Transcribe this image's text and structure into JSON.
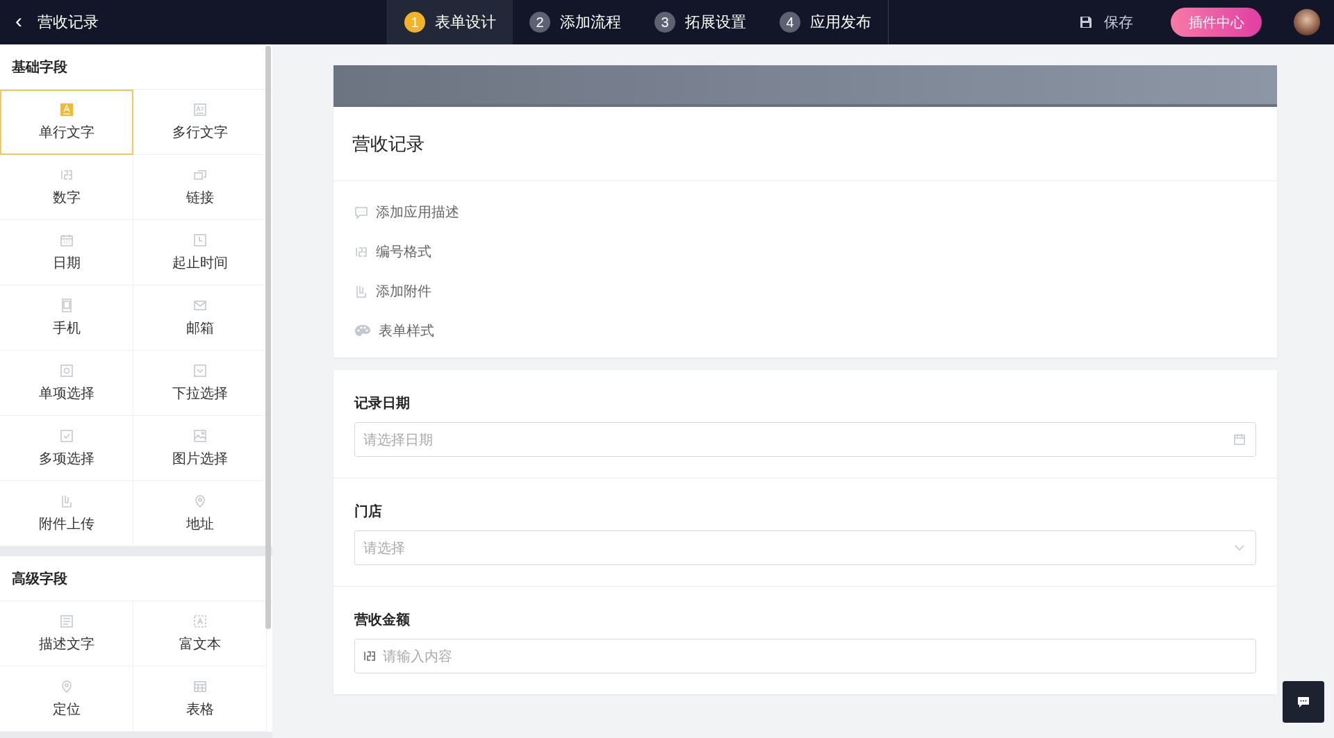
{
  "header": {
    "back": "‹",
    "title": "营收记录",
    "steps": [
      {
        "number": "1",
        "label": "表单设计",
        "selected": true
      },
      {
        "number": "2",
        "label": "添加流程",
        "selected": false
      },
      {
        "number": "3",
        "label": "拓展设置",
        "selected": false
      },
      {
        "number": "4",
        "label": "应用发布",
        "selected": false
      }
    ],
    "save": "保存",
    "plugin_button": "插件中心"
  },
  "sidebar": {
    "sections": [
      {
        "title": "基础字段",
        "items": [
          {
            "label": "单行文字",
            "selected": true
          },
          {
            "label": "多行文字",
            "selected": false
          },
          {
            "label": "数字",
            "selected": false
          },
          {
            "label": "链接",
            "selected": false
          },
          {
            "label": "日期",
            "selected": false
          },
          {
            "label": "起止时间",
            "selected": false
          },
          {
            "label": "手机",
            "selected": false
          },
          {
            "label": "邮箱",
            "selected": false
          },
          {
            "label": "单项选择",
            "selected": false
          },
          {
            "label": "下拉选择",
            "selected": false
          },
          {
            "label": "多项选择",
            "selected": false
          },
          {
            "label": "图片选择",
            "selected": false
          },
          {
            "label": "附件上传",
            "selected": false
          },
          {
            "label": "地址",
            "selected": false
          }
        ]
      },
      {
        "title": "高级字段",
        "items": [
          {
            "label": "描述文字",
            "selected": false
          },
          {
            "label": "富文本",
            "selected": false
          },
          {
            "label": "定位",
            "selected": false
          },
          {
            "label": "表格",
            "selected": false
          }
        ]
      }
    ]
  },
  "form": {
    "title": "营收记录",
    "options": [
      {
        "label": "添加应用描述"
      },
      {
        "label": "编号格式"
      },
      {
        "label": "添加附件"
      },
      {
        "label": "表单样式"
      }
    ],
    "fields": [
      {
        "kind": "date",
        "label": "记录日期",
        "placeholder": "请选择日期"
      },
      {
        "kind": "select",
        "label": "门店",
        "placeholder": "请选择"
      },
      {
        "kind": "number",
        "label": "营收金额",
        "placeholder": "请输入内容"
      }
    ]
  }
}
